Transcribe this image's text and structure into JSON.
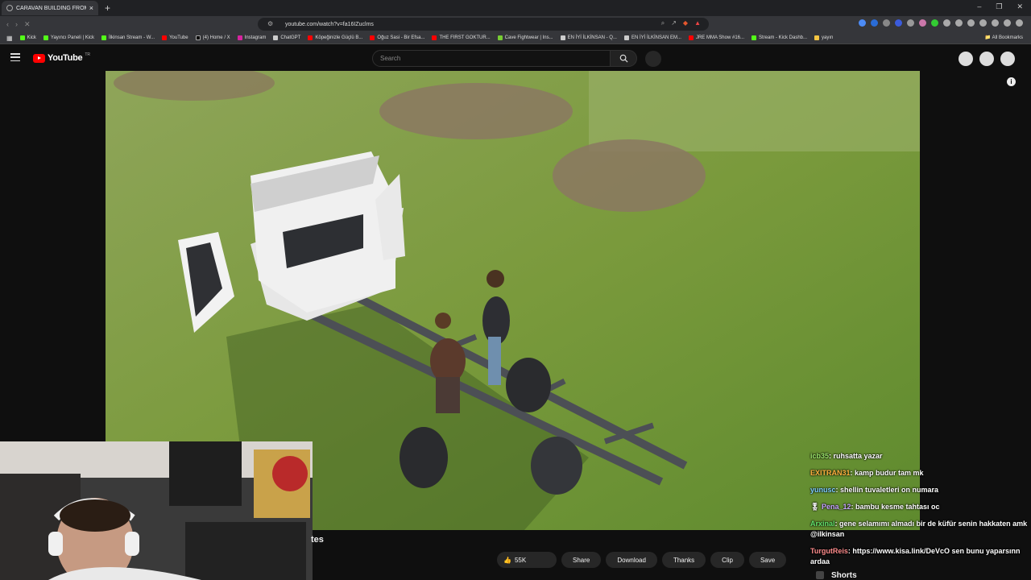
{
  "browser": {
    "tab_title": "CARAVAN BUILDING FROM Z",
    "url": "youtube.com/watch?v=fa16IZuclms",
    "bookmarks": [
      "Kick",
      "Yayıncı Paneli | Kick",
      "İlkinsan Stream - W...",
      "YouTube",
      "(4) Home / X",
      "Instagram",
      "ChatGPT",
      "Köpeğinizle Güçlü B...",
      "Oğuz Sasi - Bir Efsa...",
      "THE FIRST GOKTUR...",
      "Cave Fightwear | Ins...",
      "EN İYİ İLKİNSAN - Q...",
      "EN İYİ İLKİNSAN EM...",
      "JRE MMA Show #16...",
      "Stream - Kick Dashb...",
      "yayın"
    ],
    "all_bookmarks": "All Bookmarks"
  },
  "youtube": {
    "logo_text": "YouTube",
    "logo_country": "TR",
    "search_placeholder": "Search"
  },
  "video": {
    "title_fragment": "tes"
  },
  "actions": {
    "likes": "55K",
    "share": "Share",
    "download": "Download",
    "thanks": "Thanks",
    "clip": "Clip",
    "save": "Save"
  },
  "chat": [
    {
      "user": "icb35",
      "text": "ruhsatta yazar",
      "color": "#9be46b"
    },
    {
      "user": "EXITRAN31",
      "text": "kamp budur tam mk",
      "color": "#ffb23e"
    },
    {
      "user": "yunusc",
      "text": "shellin tuvaletleri on numara",
      "color": "#7fd0ff"
    },
    {
      "user": "Pena_12",
      "text": "bambu kesme tahtası oc",
      "color": "#c9a8ff"
    },
    {
      "user": "Arxinal",
      "text": "gene selamımı almadı bir de küfür senin hakkaten amk @ilkinsan",
      "color": "#63e36b"
    },
    {
      "user": "TurgutReis",
      "text": "https://www.kisa.link/DeVcO sen bunu yaparsınn ardaa",
      "color": "#ff8c8c"
    }
  ],
  "sidebar": {
    "shorts_label": "Shorts"
  }
}
